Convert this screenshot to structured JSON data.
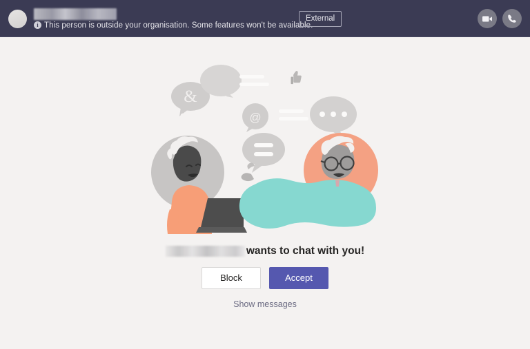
{
  "header": {
    "avatar_name": "contact-avatar",
    "contact_name_redacted": true,
    "external_notice": "This person is outside your organisation. Some features won't be available.",
    "info_icon": "info-circle-icon",
    "external_badge_label": "External",
    "actions": [
      {
        "name": "video-call-button",
        "icon": "video-camera-icon"
      },
      {
        "name": "audio-call-button",
        "icon": "phone-icon"
      }
    ],
    "colors": {
      "background": "#3b3b54",
      "text": "#e6e5ea",
      "badge_border": "#a4a4b4",
      "action_circle": "#7a7a86"
    }
  },
  "main": {
    "illustration": {
      "name": "chat-invite-illustration",
      "elements": [
        "ampersand-bubble",
        "blank-bubble",
        "text-lines",
        "thumbs-up-icon",
        "typing-dots",
        "at-mention-bubble",
        "ellipsis-bubble",
        "equals-bubble",
        "person-with-laptop",
        "person-with-glasses"
      ],
      "colors": {
        "bubble_gray": "#cfcdcc",
        "circle_gray": "#c5c3c2",
        "circle_orange": "#f4a183",
        "shirt_orange": "#f79e77",
        "clothing_teal": "#86d8d0",
        "skin_dark": "#4a4a4a",
        "skin_gray": "#9e9c9b",
        "hair_white": "#f2f0ef",
        "laptop_dark": "#4d4d4d"
      }
    },
    "headline_name_redacted": true,
    "headline_text": "wants to chat with you!",
    "buttons": [
      {
        "name": "block-button",
        "label": "Block",
        "style": "secondary"
      },
      {
        "name": "accept-button",
        "label": "Accept",
        "style": "primary"
      }
    ],
    "show_messages_link": "Show messages",
    "colors": {
      "background": "#f4f2f1",
      "headline_text": "#252423",
      "accept_bg": "#5558af",
      "block_bg": "#ffffff",
      "link_text": "#6b6b82"
    }
  }
}
